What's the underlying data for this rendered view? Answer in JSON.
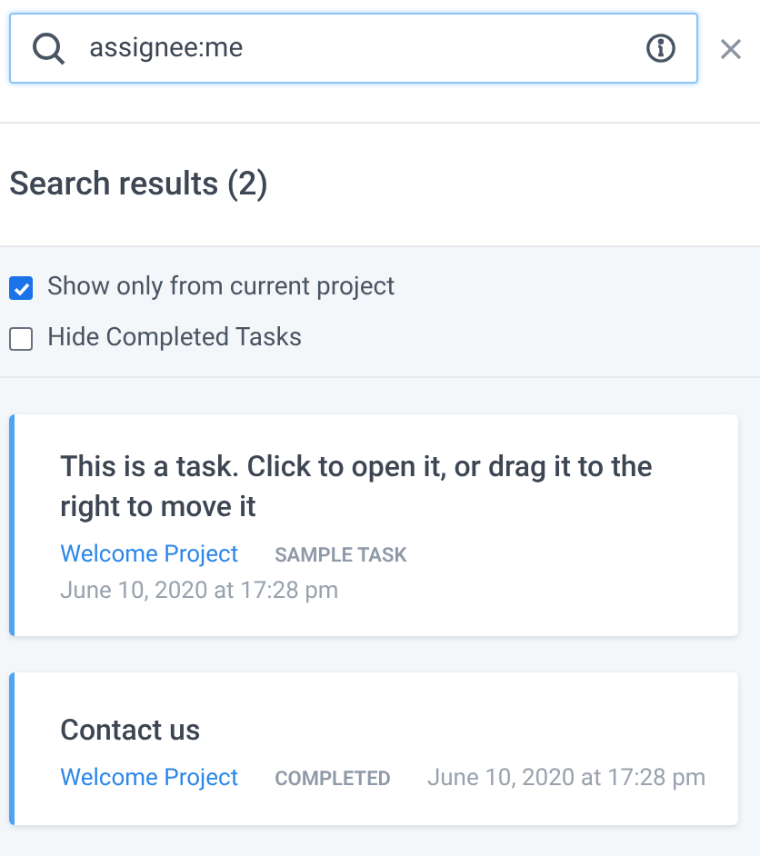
{
  "search": {
    "value": "assignee:me"
  },
  "heading": "Search results (2)",
  "filters": [
    {
      "label": "Show only from current project",
      "checked": true
    },
    {
      "label": "Hide Completed Tasks",
      "checked": false
    }
  ],
  "results": [
    {
      "kind": "stacked",
      "title": "This is a task. Click to open it, or drag it to the right to move it",
      "project": "Welcome Project",
      "status": "SAMPLE TASK",
      "date": "June 10, 2020 at 17:28 pm"
    },
    {
      "kind": "inline",
      "title": "Contact us",
      "project": "Welcome Project",
      "status": "COMPLETED",
      "date": "June 10, 2020 at 17:28 pm"
    }
  ]
}
